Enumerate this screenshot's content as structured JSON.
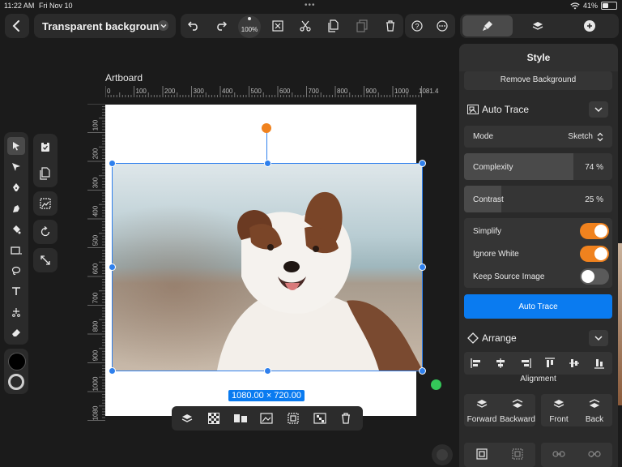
{
  "status_bar": {
    "time": "11:22 AM",
    "date": "Fri Nov 10",
    "dots": "•••",
    "battery": "41%",
    "battery_level": 0.41
  },
  "toolbar": {
    "document_title": "Transparent background",
    "zoom": "100%",
    "icons": [
      "back-icon",
      "chevron-down-icon",
      "undo-icon",
      "redo-icon",
      "zoom-dial",
      "transform-icon",
      "scissors-icon",
      "duplicate-icon",
      "paste-icon",
      "trash-icon",
      "help-icon",
      "more-icon"
    ]
  },
  "panel_tabs": [
    "style-brush-tab",
    "layers-tab",
    "add-tab"
  ],
  "canvas": {
    "artboard_label": "Artboard",
    "ruler_h": [
      "0",
      "100",
      "200",
      "300",
      "400",
      "500",
      "600",
      "700",
      "800",
      "900",
      "1000",
      "1081.4"
    ],
    "ruler_v": [
      "100",
      "200",
      "300",
      "400",
      "500",
      "600",
      "700",
      "800",
      "900",
      "1000",
      "1080"
    ],
    "size_badge": "1080.00 × 720.00"
  },
  "left_tools": [
    "select-tool",
    "direct-select-tool",
    "pen-tool",
    "vector-brush-tool",
    "fill-tool",
    "rectangle-tool",
    "lasso-tool",
    "text-tool",
    "knife-tool",
    "eraser-tool"
  ],
  "colors": {
    "accent": "#0a7bf0",
    "toggle_on": "#f0821e",
    "fill_swatch": "#000000",
    "handle_orange": "#f0821e",
    "handle_green": "#34c759"
  },
  "panel": {
    "title": "Style",
    "remove_background": "Remove Background",
    "auto_trace": {
      "title": "Auto Trace",
      "mode_label": "Mode",
      "mode_value": "Sketch",
      "complexity_label": "Complexity",
      "complexity_value": "74 %",
      "complexity_level": 0.74,
      "contrast_label": "Contrast",
      "contrast_value": "25 %",
      "contrast_level": 0.25,
      "simplify_label": "Simplify",
      "simplify_on": true,
      "ignore_white_label": "Ignore White",
      "ignore_white_on": true,
      "keep_source_label": "Keep Source Image",
      "keep_source_on": false,
      "button": "Auto Trace"
    },
    "arrange": {
      "title": "Arrange",
      "alignment_label": "Alignment",
      "order_buttons": [
        "Forward",
        "Backward",
        "Front",
        "Back"
      ]
    }
  }
}
